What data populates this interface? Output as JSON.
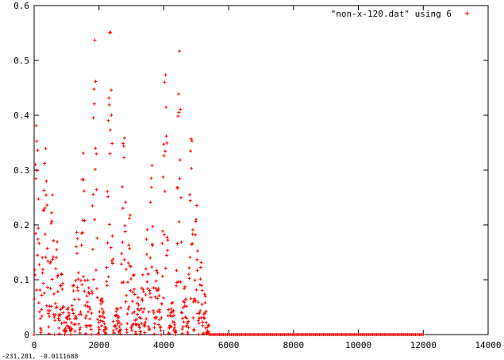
{
  "window": {
    "status_readout": "-231.281, -0.0111688"
  },
  "colors": {
    "series": "#ff0000",
    "axes": "#000000",
    "background": "#ffffff"
  },
  "chart_data": {
    "type": "scatter",
    "title": "",
    "xlabel": "",
    "ylabel": "",
    "xlim": [
      0,
      14000
    ],
    "ylim": [
      0,
      0.6
    ],
    "xticks": [
      "0",
      "2000",
      "4000",
      "6000",
      "8000",
      "10000",
      "12000",
      "14000"
    ],
    "yticks": [
      "0",
      "0.1",
      "0.2",
      "0.3",
      "0.4",
      "0.5",
      "0.6"
    ],
    "grid": false,
    "legend_position": "top-right",
    "marker": "+",
    "series": [
      {
        "name": "\"non-x-120.dat\" using 6",
        "marker": "+",
        "color": "#ff0000",
        "x_range": [
          0,
          12000
        ],
        "nonzero_until": 5400,
        "envelope_peaks": [
          {
            "x": 60,
            "y": 0.4
          },
          {
            "x": 350,
            "y": 0.34
          },
          {
            "x": 560,
            "y": 0.26
          },
          {
            "x": 700,
            "y": 0.18
          },
          {
            "x": 840,
            "y": 0.12
          },
          {
            "x": 1050,
            "y": 0.05
          },
          {
            "x": 1220,
            "y": 0.1
          },
          {
            "x": 1310,
            "y": 0.2
          },
          {
            "x": 1520,
            "y": 0.34
          },
          {
            "x": 1660,
            "y": 0.1
          },
          {
            "x": 1870,
            "y": 0.54
          },
          {
            "x": 2070,
            "y": 0.07
          },
          {
            "x": 2350,
            "y": 0.57
          },
          {
            "x": 2550,
            "y": 0.05
          },
          {
            "x": 2770,
            "y": 0.39
          },
          {
            "x": 2950,
            "y": 0.23
          },
          {
            "x": 3070,
            "y": 0.12
          },
          {
            "x": 3200,
            "y": 0.07
          },
          {
            "x": 3350,
            "y": 0.11
          },
          {
            "x": 3480,
            "y": 0.2
          },
          {
            "x": 3620,
            "y": 0.33
          },
          {
            "x": 3780,
            "y": 0.12
          },
          {
            "x": 4050,
            "y": 0.49
          },
          {
            "x": 4250,
            "y": 0.06
          },
          {
            "x": 4480,
            "y": 0.52
          },
          {
            "x": 4640,
            "y": 0.09
          },
          {
            "x": 4850,
            "y": 0.39
          },
          {
            "x": 5000,
            "y": 0.25
          },
          {
            "x": 5150,
            "y": 0.14
          },
          {
            "x": 5270,
            "y": 0.08
          },
          {
            "x": 5380,
            "y": 0.02
          }
        ]
      }
    ]
  }
}
